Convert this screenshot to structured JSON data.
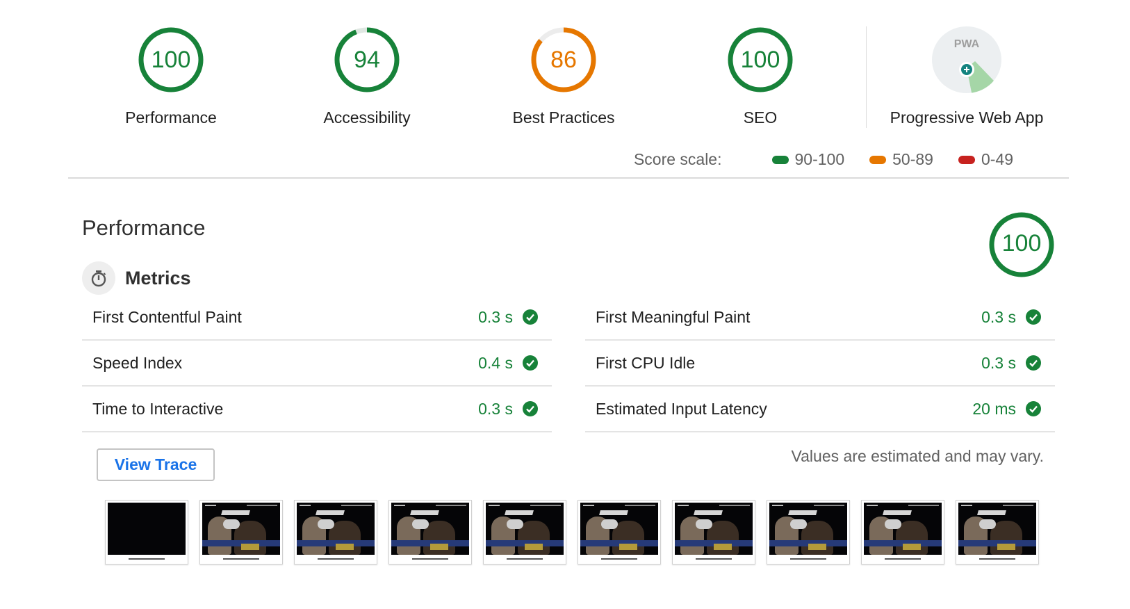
{
  "categories": [
    {
      "id": "performance",
      "label": "Performance",
      "score": 100,
      "rating": "pass"
    },
    {
      "id": "accessibility",
      "label": "Accessibility",
      "score": 94,
      "rating": "pass"
    },
    {
      "id": "best-practices",
      "label": "Best Practices",
      "score": 86,
      "rating": "average"
    },
    {
      "id": "seo",
      "label": "SEO",
      "score": 100,
      "rating": "pass"
    }
  ],
  "pwa": {
    "label": "Progressive Web App",
    "badge_text": "PWA"
  },
  "score_scale": {
    "label": "Score scale:",
    "items": [
      {
        "range": "90-100",
        "color": "#178239"
      },
      {
        "range": "50-89",
        "color": "#e67700"
      },
      {
        "range": "0-49",
        "color": "#c7221f"
      }
    ]
  },
  "performance_section": {
    "title": "Performance",
    "score": 100,
    "metrics_title": "Metrics",
    "metrics_left": [
      {
        "name": "First Contentful Paint",
        "value": "0.3 s"
      },
      {
        "name": "Speed Index",
        "value": "0.4 s"
      },
      {
        "name": "Time to Interactive",
        "value": "0.3 s"
      }
    ],
    "metrics_right": [
      {
        "name": "First Meaningful Paint",
        "value": "0.3 s"
      },
      {
        "name": "First CPU Idle",
        "value": "0.3 s"
      },
      {
        "name": "Estimated Input Latency",
        "value": "20 ms"
      }
    ],
    "view_trace_label": "View Trace",
    "disclaimer": "Values are estimated and may vary."
  },
  "filmstrip_frames": [
    "blank",
    "scene",
    "scene",
    "scene",
    "scene",
    "scene",
    "scene",
    "scene",
    "scene",
    "scene"
  ],
  "colors": {
    "pass": "#178239",
    "average": "#e67700",
    "fail": "#c7221f",
    "link": "#1a73e8"
  },
  "icons": {
    "metrics": "stopwatch-icon",
    "metric_status": "check-circle-icon",
    "pwa": "pwa-badge-icon"
  }
}
